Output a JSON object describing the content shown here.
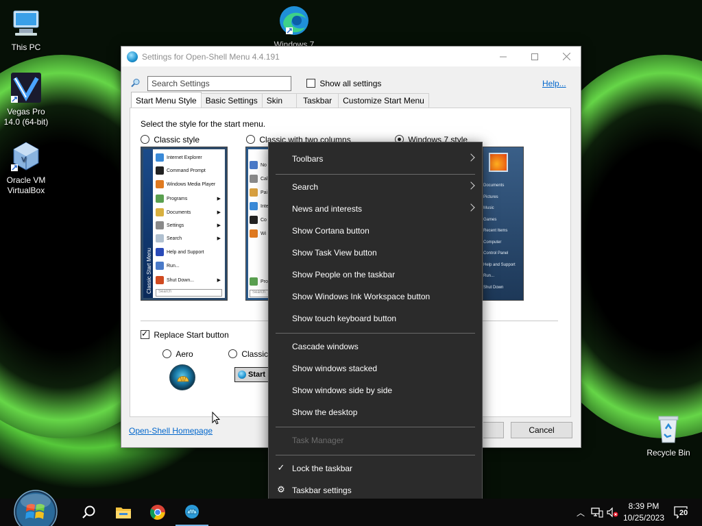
{
  "desktop": {
    "icons": [
      {
        "label": "This PC"
      },
      {
        "label": "Vegas Pro 14.0 (64-bit)"
      },
      {
        "label": "Oracle VM VirtualBox"
      },
      {
        "label": "Windows 7"
      },
      {
        "label": "Recycle Bin"
      }
    ]
  },
  "settings_window": {
    "title": "Settings for Open-Shell Menu 4.4.191",
    "search_placeholder": "Search Settings",
    "show_all_label": "Show all settings",
    "help_link": "Help...",
    "tabs": [
      {
        "label": "Start Menu Style"
      },
      {
        "label": "Basic Settings"
      },
      {
        "label": "Skin"
      },
      {
        "label": "Taskbar"
      },
      {
        "label": "Customize Start Menu"
      }
    ],
    "instruction": "Select the style for the start menu.",
    "styles": [
      {
        "label": "Classic style",
        "selected": false
      },
      {
        "label": "Classic with two columns",
        "selected": false
      },
      {
        "label": "Windows 7 style",
        "selected": true
      }
    ],
    "classic_preview": {
      "strip_text": "Classic Start Menu",
      "items": [
        "Internet Explorer",
        "Command Prompt",
        "Windows Media Player",
        "Programs",
        "Documents",
        "Settings",
        "Search",
        "Help and Support",
        "Run...",
        "Shut Down..."
      ],
      "search_text": "Search"
    },
    "two_col_preview": {
      "items": [
        "No",
        "Cal",
        "Pai",
        "Inte",
        "Co",
        "Wi",
        "Pro"
      ],
      "search_text": "Search"
    },
    "win7_preview": {
      "items": [
        "Documents",
        "Pictures",
        "Music",
        "Games",
        "Recent Items",
        "Computer",
        "Control Panel",
        "Help and Support",
        "Run...",
        "Shut Down"
      ]
    },
    "replace_start_label": "Replace Start button",
    "replace_start_checked": true,
    "button_styles": [
      {
        "label": "Aero",
        "selected": false
      },
      {
        "label": "Classic",
        "selected": false
      }
    ],
    "start_button_text": "Start",
    "homepage_link": "Open-Shell Homepage",
    "cancel_label": "Cancel"
  },
  "context_menu": {
    "items": [
      {
        "label": "Toolbars",
        "submenu": true
      },
      {
        "label": "Search",
        "submenu": true
      },
      {
        "label": "News and interests",
        "submenu": true
      },
      {
        "label": "Show Cortana button"
      },
      {
        "label": "Show Task View button"
      },
      {
        "label": "Show People on the taskbar"
      },
      {
        "label": "Show Windows Ink Workspace button"
      },
      {
        "label": "Show touch keyboard button"
      },
      {
        "label": "Cascade windows"
      },
      {
        "label": "Show windows stacked"
      },
      {
        "label": "Show windows side by side"
      },
      {
        "label": "Show the desktop"
      },
      {
        "label": "Task Manager",
        "disabled": true
      },
      {
        "label": "Lock the taskbar",
        "checked": true
      },
      {
        "label": "Taskbar settings",
        "icon": "gear-icon"
      }
    ]
  },
  "taskbar": {
    "time": "8:39 PM",
    "date": "10/25/2023",
    "notification_count": "20"
  },
  "colors": {
    "menu_bg": "#2b2b2b",
    "taskbar_bg": "#0b0b0b",
    "link": "#0066cc",
    "wallpaper_glow": "#56c83a"
  }
}
